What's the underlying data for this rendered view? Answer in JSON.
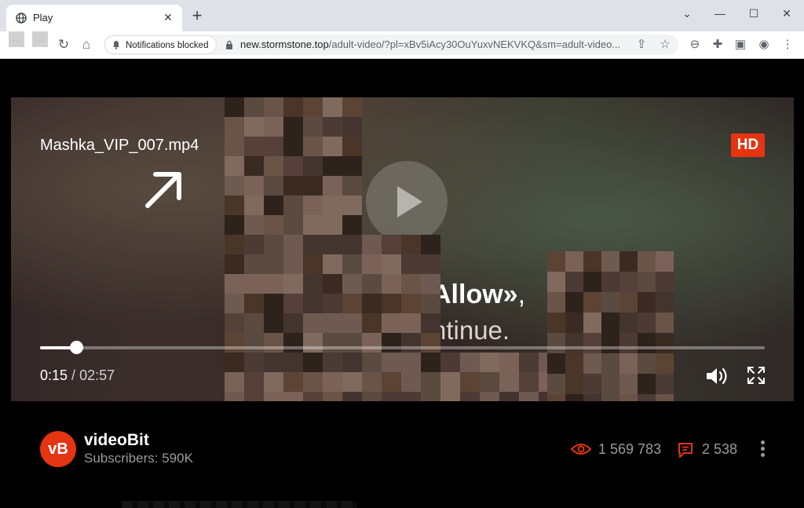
{
  "browser": {
    "tab_title": "Play",
    "new_tab_symbol": "+",
    "notification_chip": "Notifications blocked",
    "url_host": "new.stormstone.top",
    "url_path": "/adult-video/?pl=xBv5iAcy30OuYuxvNEKVKQ&sm=adult-video...",
    "window_controls": [
      "chevron-down-icon",
      "minimize-icon",
      "maximize-icon",
      "close-icon"
    ],
    "nav_icons": [
      "back-icon",
      "forward-icon",
      "reload-icon",
      "home-icon"
    ],
    "toolbar_icons": [
      "share-icon",
      "bookmark-star-icon",
      "blocked-extension-icon",
      "extensions-puzzle-icon",
      "side-panel-icon",
      "profile-avatar-icon",
      "menu-kebab-icon"
    ]
  },
  "player": {
    "file_name": "Mashka_VIP_007.mp4",
    "hd_badge": "HD",
    "overlay_line1_bold": "Allow»",
    "overlay_line1_tail": ",",
    "overlay_line2": "ntinue.",
    "progress_fraction": 0.05,
    "time_current": "0:15",
    "time_separator": " / ",
    "time_total": "02:57"
  },
  "channel": {
    "avatar_text": "vB",
    "name": "videoBit",
    "subscribers": "Subscribers: 590K",
    "views": "1 569 783",
    "comments": "2 538"
  },
  "colors": {
    "accent": "#e53412",
    "muted_text": "#9a9a9a"
  }
}
